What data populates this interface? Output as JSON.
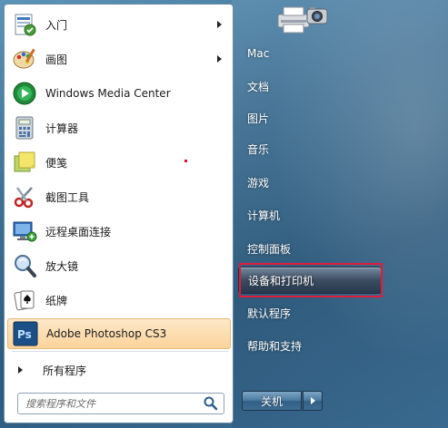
{
  "programs": [
    {
      "label": "入门",
      "icon": "getting-started-icon",
      "has_submenu": true
    },
    {
      "label": "画图",
      "icon": "paint-icon",
      "has_submenu": true
    },
    {
      "label": "Windows Media Center",
      "icon": "media-center-icon",
      "has_submenu": false
    },
    {
      "label": "计算器",
      "icon": "calculator-icon",
      "has_submenu": false
    },
    {
      "label": "便笺",
      "icon": "sticky-notes-icon",
      "has_submenu": false
    },
    {
      "label": "截图工具",
      "icon": "snipping-tool-icon",
      "has_submenu": false
    },
    {
      "label": "远程桌面连接",
      "icon": "remote-desktop-icon",
      "has_submenu": false
    },
    {
      "label": "放大镜",
      "icon": "magnifier-icon",
      "has_submenu": false
    },
    {
      "label": "纸牌",
      "icon": "solitaire-icon",
      "has_submenu": false
    },
    {
      "label": "Adobe Photoshop CS3",
      "icon": "photoshop-icon",
      "has_submenu": false,
      "highlighted": true
    }
  ],
  "all_programs_label": "所有程序",
  "search": {
    "placeholder": "搜索程序和文件"
  },
  "right_items": [
    {
      "label": "Mac"
    },
    {
      "label": "文档"
    },
    {
      "label": "图片"
    },
    {
      "label": "音乐"
    },
    {
      "label": "游戏"
    },
    {
      "label": "计算机"
    },
    {
      "label": "控制面板"
    },
    {
      "label": "设备和打印机",
      "selected": true
    },
    {
      "label": "默认程序"
    },
    {
      "label": "帮助和支持"
    }
  ],
  "shutdown_label": "关机",
  "colors": {
    "highlight_box": "#e01b3c",
    "accent_blue": "#3e6f93"
  }
}
